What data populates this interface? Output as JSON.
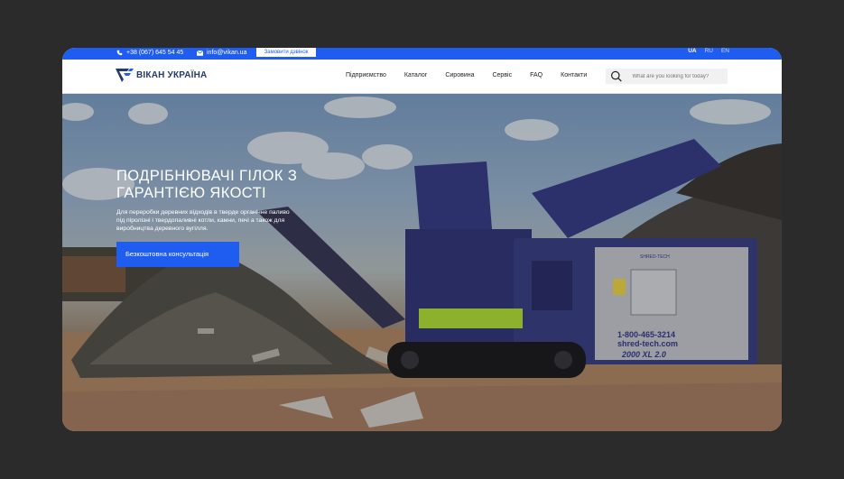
{
  "topbar": {
    "phone": "+38 (067) 645 54 45",
    "email": "info@vikan.ua",
    "call_button": "Замовити дзвінок",
    "languages": [
      "UA",
      "RU",
      "EN"
    ],
    "active_language": "UA"
  },
  "brand": {
    "name": "ВІКАН УКРАЇНА"
  },
  "nav": {
    "items": [
      "Підприємство",
      "Каталог",
      "Сировина",
      "Сервіс",
      "FAQ",
      "Контакти"
    ]
  },
  "search": {
    "placeholder": "What are you looking for today?"
  },
  "hero": {
    "title": "ПОДРІБНЮВАЧІ ГІЛОК З ГАРАНТІЄЮ ЯКОСТІ",
    "description": "Для переробки деревних відходів в тверде органічне паливо під піролізні і твердопаливні котли, камни, печі а також для виробництва деревного вугілля.",
    "cta": "Безкоштовна консультація",
    "machine_text": {
      "phone": "1-800-465-3214",
      "site": "shred-tech.com",
      "model": "2000 XL 2.0",
      "brand": "SHRED-TECH"
    }
  },
  "colors": {
    "accent": "#1f5cf0",
    "frame_bg": "#2b2b2b",
    "brand_text": "#243a6b"
  }
}
